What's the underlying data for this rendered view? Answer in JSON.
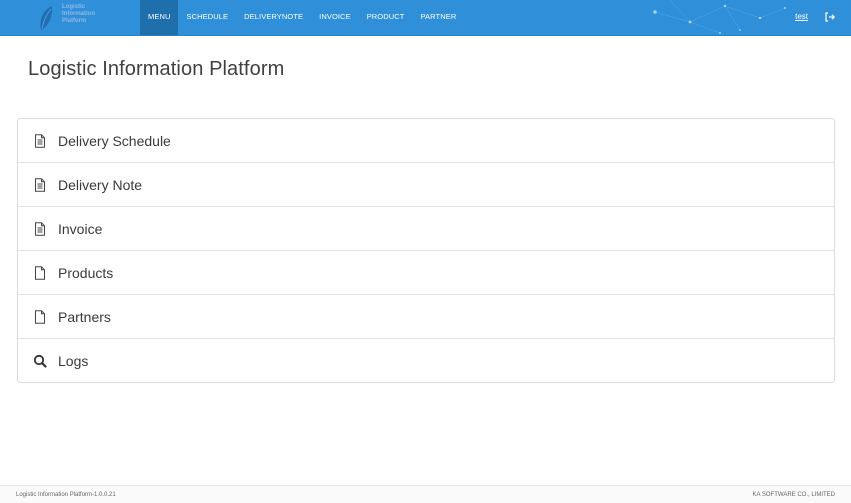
{
  "brand": {
    "logo_text": "Logistic\nInformation\nPlatform"
  },
  "nav": {
    "items": [
      {
        "label": "MENU"
      },
      {
        "label": "SCHEDULE"
      },
      {
        "label": "DELIVERYNOTE"
      },
      {
        "label": "INVOICE"
      },
      {
        "label": "PRODUCT"
      },
      {
        "label": "PARTNER"
      }
    ],
    "active": "MENU",
    "user": "test",
    "logout_icon": "sign-out-icon"
  },
  "page": {
    "title": "Logistic Information Platform"
  },
  "menu": {
    "items": [
      {
        "label": "Delivery Schedule",
        "icon": "document-lines-icon"
      },
      {
        "label": "Delivery Note",
        "icon": "document-lines-icon"
      },
      {
        "label": "Invoice",
        "icon": "document-lines-icon"
      },
      {
        "label": "Products",
        "icon": "document-blank-icon"
      },
      {
        "label": "Partners",
        "icon": "document-blank-icon"
      },
      {
        "label": "Logs",
        "icon": "search-icon"
      }
    ]
  },
  "footer": {
    "left": "Logistic Information Platform-1.0.0.21",
    "right": "KA SOFTWARE CO., LIMITED"
  },
  "colors": {
    "navbar": "#2f8fd8",
    "nav_active": "#1f6fad",
    "text": "#3a3a3a"
  }
}
